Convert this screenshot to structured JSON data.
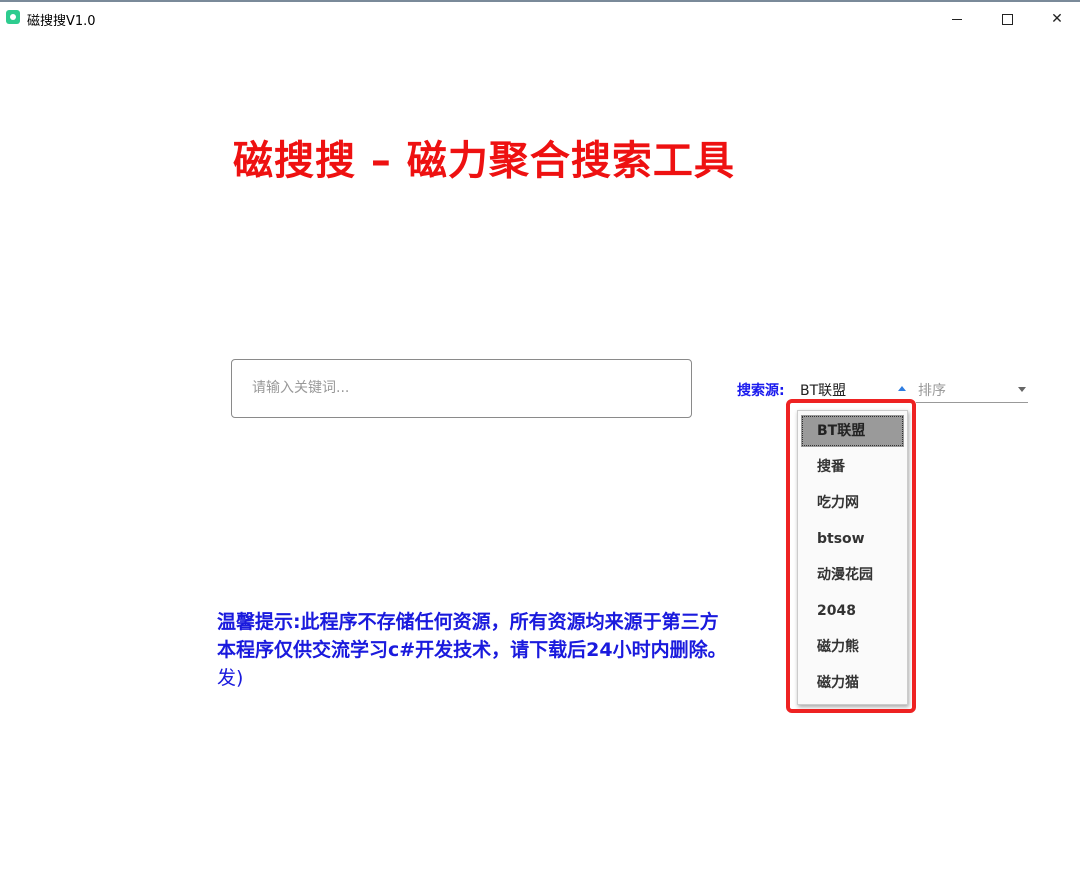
{
  "window": {
    "title": "磁搜搜V1.0",
    "controls": {
      "minimize": "minimize",
      "maximize": "maximize",
      "close": "✕"
    }
  },
  "header": {
    "title": "磁搜搜 – 磁力聚合搜索工具"
  },
  "search": {
    "placeholder": "请输入关键词...",
    "value": ""
  },
  "source": {
    "label": "搜索源:",
    "selected": "BT联盟",
    "options": [
      "BT联盟",
      "搜番",
      "吃力网",
      "btsow",
      "动漫花园",
      "2048",
      "磁力熊",
      "磁力猫"
    ]
  },
  "sort": {
    "placeholder": "排序"
  },
  "notice": {
    "line1": "温馨提示:此程序不存储任何资源，所有资源均来源于第三方",
    "line2": "本程序仅供交流学习c#开发技术，请下载后24小时内删除。",
    "line3": "发)"
  },
  "colors": {
    "title": "#ee1111",
    "notice": "#1a1add",
    "highlight_border": "#ee2222",
    "accent": "#2f7de1"
  }
}
